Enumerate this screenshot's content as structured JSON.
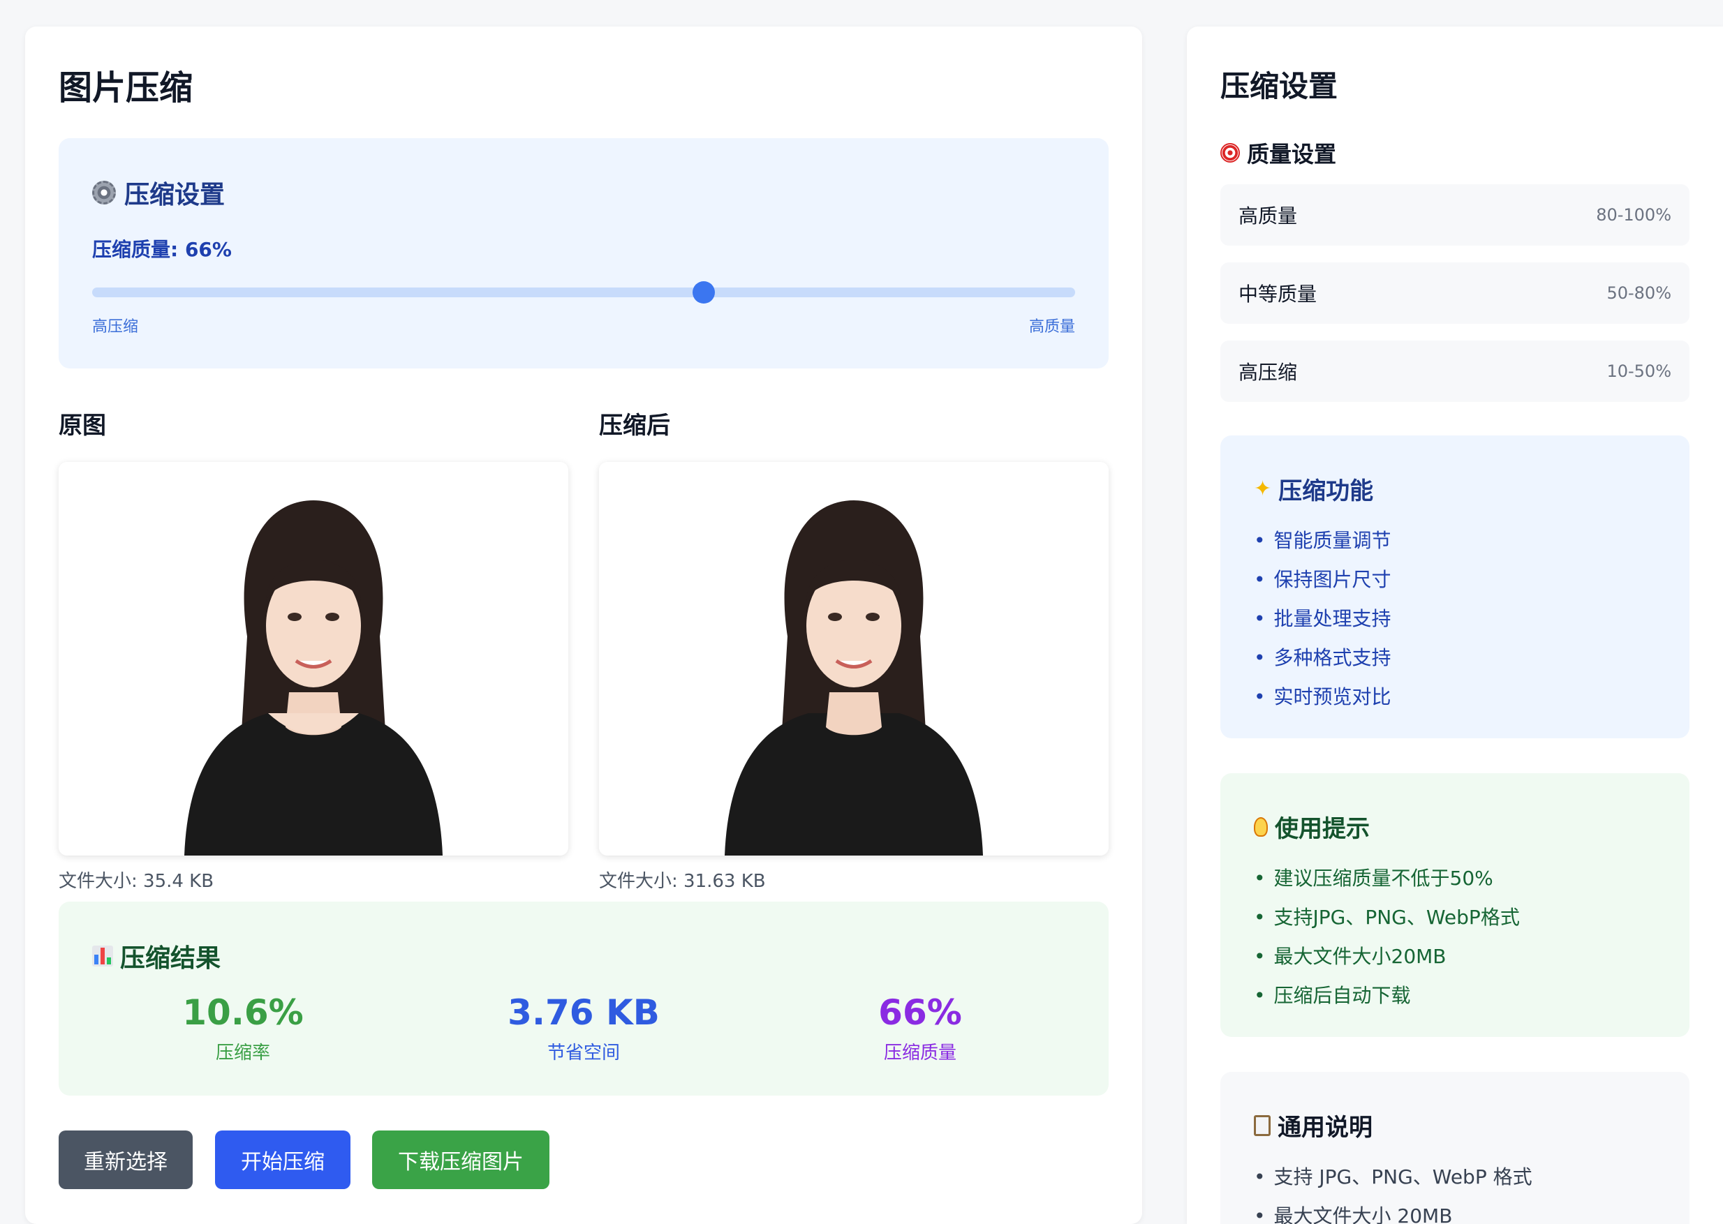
{
  "main": {
    "title": "图片压缩",
    "settings": {
      "title": "压缩设置",
      "quality_label": "压缩质量: 66%",
      "quality_value": 66,
      "slider_left_label": "高压缩",
      "slider_right_label": "高质量"
    },
    "original": {
      "title": "原图",
      "file_size": "文件大小: 35.4 KB"
    },
    "compressed": {
      "title": "压缩后",
      "file_size": "文件大小: 31.63 KB"
    },
    "result": {
      "title": "压缩结果",
      "stats": [
        {
          "value": "10.6%",
          "label": "压缩率",
          "color": "#3a9f45"
        },
        {
          "value": "3.76 KB",
          "label": "节省空间",
          "color": "#2f5be0"
        },
        {
          "value": "66%",
          "label": "压缩质量",
          "color": "#8a2be2"
        }
      ]
    },
    "buttons": {
      "reselect": "重新选择",
      "start": "开始压缩",
      "download": "下载压缩图片"
    }
  },
  "sidebar": {
    "title": "压缩设置",
    "quality_section_title": "质量设置",
    "quality_levels": [
      {
        "name": "高质量",
        "range": "80-100%"
      },
      {
        "name": "中等质量",
        "range": "50-80%"
      },
      {
        "name": "高压缩",
        "range": "10-50%"
      }
    ],
    "features": {
      "title": "压缩功能",
      "items": [
        "智能质量调节",
        "保持图片尺寸",
        "批量处理支持",
        "多种格式支持",
        "实时预览对比"
      ]
    },
    "tips": {
      "title": "使用提示",
      "items": [
        "建议压缩质量不低于50%",
        "支持JPG、PNG、WebP格式",
        "最大文件大小20MB",
        "压缩后自动下载"
      ]
    },
    "general": {
      "title": "通用说明",
      "items": [
        "支持 JPG、PNG、WebP 格式",
        "最大文件大小 20MB"
      ]
    }
  },
  "colors": {
    "accent_blue": "#3b76f0",
    "button_gray": "#4b5563",
    "button_blue": "#2f5bf0",
    "button_green": "#3aa347"
  }
}
